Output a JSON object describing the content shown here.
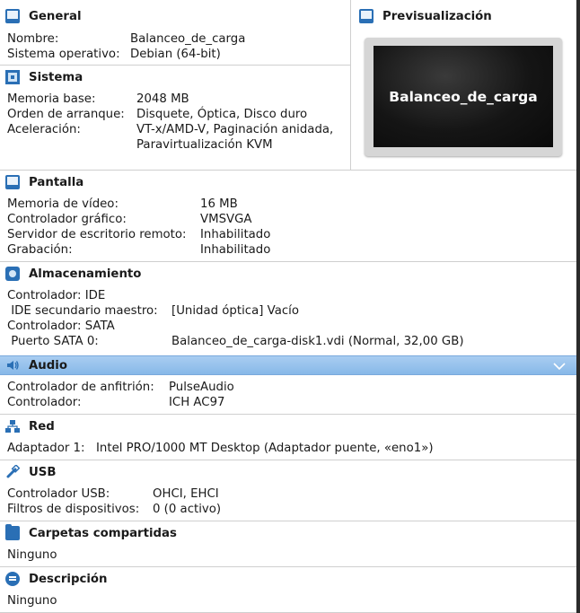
{
  "general": {
    "title": "General",
    "rows": [
      {
        "key": "Nombre:",
        "value": "Balanceo_de_carga"
      },
      {
        "key": "Sistema operativo:",
        "value": "Debian (64-bit)"
      }
    ]
  },
  "preview": {
    "title": "Previsualización",
    "screen_text": "Balanceo_de_carga"
  },
  "sistema": {
    "title": "Sistema",
    "rows": [
      {
        "key": "Memoria base:",
        "value": "2048 MB"
      },
      {
        "key": "Orden de arranque:",
        "value": "Disquete, Óptica, Disco duro"
      },
      {
        "key": "Aceleración:",
        "value": "VT-x/AMD-V, Paginación anidada,"
      },
      {
        "key": "",
        "value": "Paravirtualización KVM"
      }
    ]
  },
  "pantalla": {
    "title": "Pantalla",
    "rows": [
      {
        "key": "Memoria de vídeo:",
        "value": "16 MB"
      },
      {
        "key": "Controlador gráfico:",
        "value": "VMSVGA"
      },
      {
        "key": "Servidor de escritorio remoto:",
        "value": "Inhabilitado"
      },
      {
        "key": "Grabación:",
        "value": "Inhabilitado"
      }
    ]
  },
  "almacenamiento": {
    "title": "Almacenamiento",
    "rows": [
      {
        "key": "Controlador: IDE",
        "value": ""
      },
      {
        "key": " IDE secundario maestro:",
        "value": "[Unidad óptica] Vacío"
      },
      {
        "key": "Controlador: SATA",
        "value": ""
      },
      {
        "key": " Puerto SATA 0:",
        "value": "Balanceo_de_carga-disk1.vdi (Normal, 32,00 GB)"
      }
    ]
  },
  "audio": {
    "title": "Audio",
    "rows": [
      {
        "key": "Controlador de anfitrión:",
        "value": "PulseAudio"
      },
      {
        "key": "Controlador:",
        "value": "ICH AC97"
      }
    ]
  },
  "red": {
    "title": "Red",
    "rows": [
      {
        "key": "Adaptador 1:",
        "value": "Intel PRO/1000 MT Desktop (Adaptador puente, «eno1»)"
      }
    ]
  },
  "usb": {
    "title": "USB",
    "rows": [
      {
        "key": "Controlador USB:",
        "value": "OHCI, EHCI"
      },
      {
        "key": "Filtros de dispositivos:",
        "value": "0 (0 activo)"
      }
    ]
  },
  "carpetas": {
    "title": "Carpetas compartidas",
    "value": "Ninguno"
  },
  "descripcion": {
    "title": "Descripción",
    "value": "Ninguno"
  },
  "colors": {
    "accent": "#2a6fb5",
    "selected_bar": "#a9cdf1",
    "separator": "#cfcfcf"
  }
}
